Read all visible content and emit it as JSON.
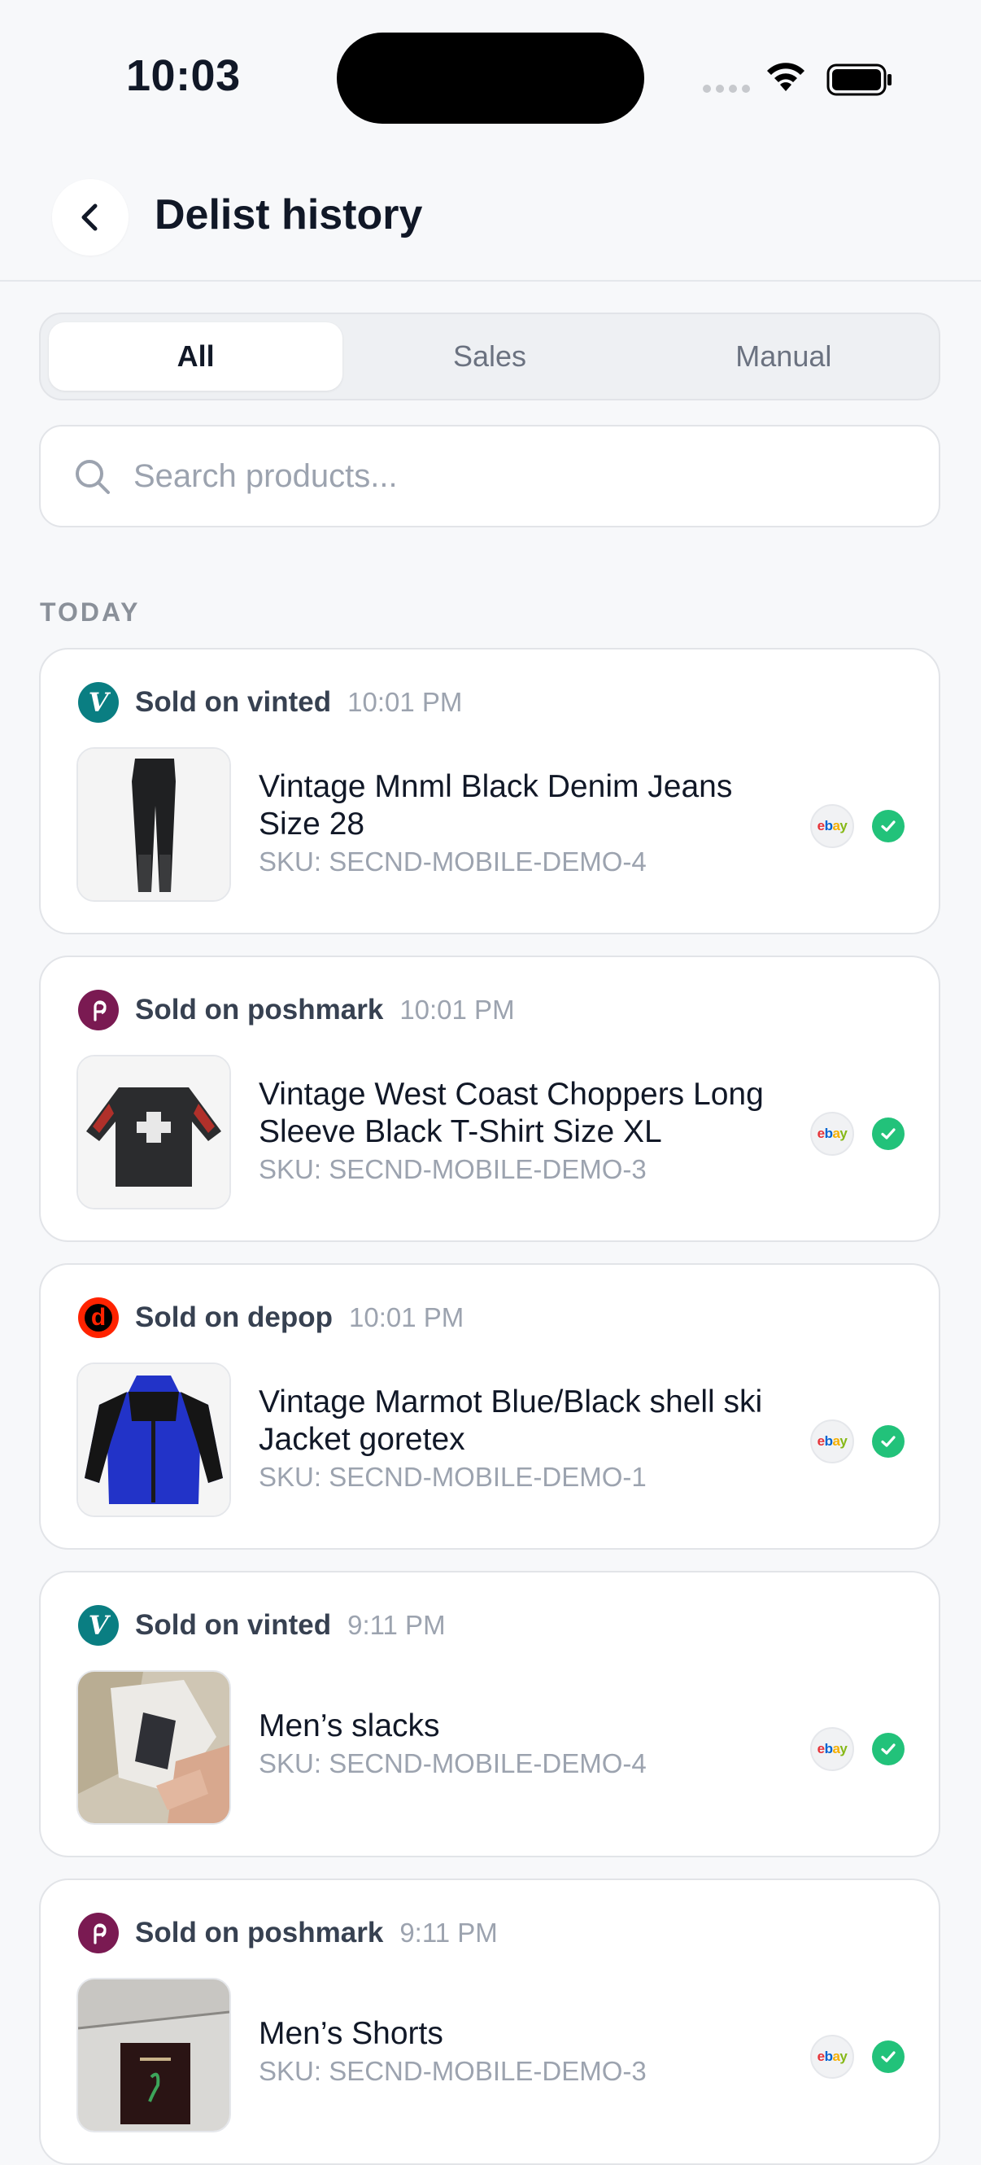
{
  "status_bar": {
    "time": "10:03"
  },
  "header": {
    "title": "Delist history"
  },
  "tabs": [
    {
      "label": "All",
      "active": true
    },
    {
      "label": "Sales",
      "active": false
    },
    {
      "label": "Manual",
      "active": false
    }
  ],
  "search": {
    "placeholder": "Search products...",
    "value": ""
  },
  "section": {
    "label": "TODAY"
  },
  "items": [
    {
      "platform": "vinted",
      "icon_letter": "V",
      "sold_label": "Sold on vinted",
      "time": "10:01 PM",
      "title": "Vintage Mnml Black Denim Jeans Size 28",
      "sku": "SKU: SECND-MOBILE-DEMO-4",
      "delisted_from": "ebay",
      "status": "check"
    },
    {
      "platform": "poshmark",
      "icon_letter": "P",
      "sold_label": "Sold on poshmark",
      "time": "10:01 PM",
      "title": "Vintage West Coast Choppers Long Sleeve Black T-Shirt Size XL",
      "sku": "SKU: SECND-MOBILE-DEMO-3",
      "delisted_from": "ebay",
      "status": "check"
    },
    {
      "platform": "depop",
      "icon_letter": "d",
      "sold_label": "Sold on depop",
      "time": "10:01 PM",
      "title": "Vintage Marmot Blue/Black shell ski Jacket goretex",
      "sku": "SKU: SECND-MOBILE-DEMO-1",
      "delisted_from": "ebay",
      "status": "check"
    },
    {
      "platform": "vinted",
      "icon_letter": "V",
      "sold_label": "Sold on vinted",
      "time": "9:11 PM",
      "title": "Men’s slacks",
      "sku": "SKU: SECND-MOBILE-DEMO-4",
      "delisted_from": "ebay",
      "status": "check"
    },
    {
      "platform": "poshmark",
      "icon_letter": "P",
      "sold_label": "Sold on poshmark",
      "time": "9:11 PM",
      "title": "Men’s Shorts",
      "sku": "SKU: SECND-MOBILE-DEMO-3",
      "delisted_from": "ebay",
      "status": "check"
    }
  ],
  "ebay_badge_text": "ebay",
  "colors": {
    "vinted": "#0a7e82",
    "poshmark": "#7a1a52",
    "depop": "#ff2300",
    "success": "#22c27a"
  }
}
